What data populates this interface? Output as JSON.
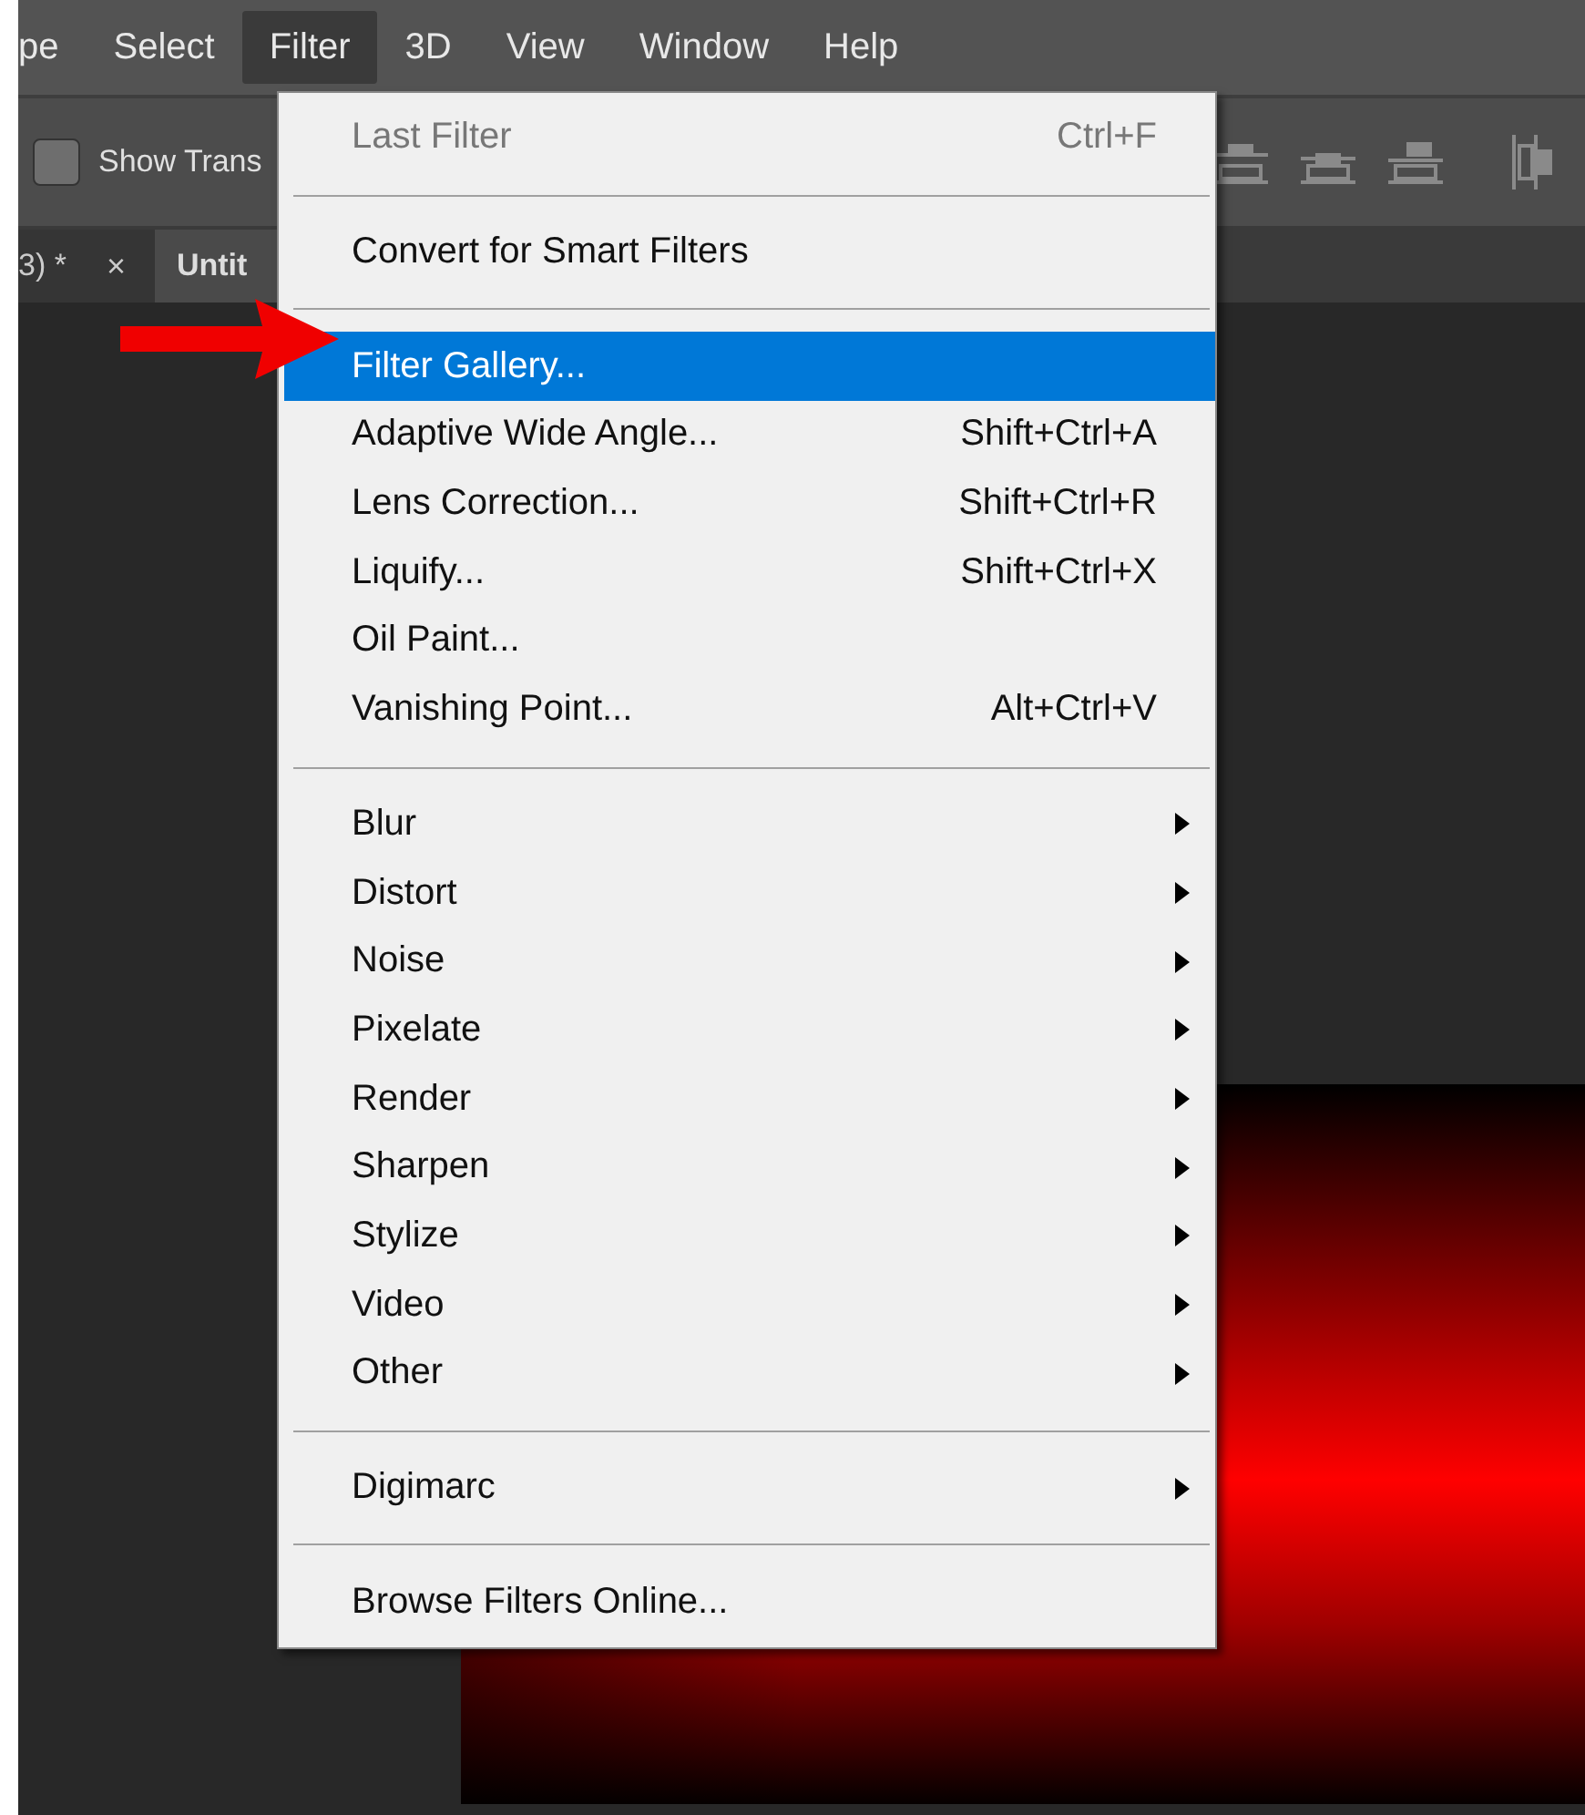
{
  "menubar": [
    {
      "label": "pe",
      "selected": false
    },
    {
      "label": "Select",
      "selected": false
    },
    {
      "label": "Filter",
      "selected": true
    },
    {
      "label": "3D",
      "selected": false
    },
    {
      "label": "View",
      "selected": false
    },
    {
      "label": "Window",
      "selected": false
    },
    {
      "label": "Help",
      "selected": false
    }
  ],
  "options_bar": {
    "checkbox": {
      "label": "Show Trans",
      "checked": false
    }
  },
  "document_tabs": [
    {
      "label": "3) *",
      "close": "×",
      "selected": false
    },
    {
      "label": "Untit",
      "selected": true
    }
  ],
  "filter_menu": [
    {
      "kind": "item",
      "label": "Last Filter",
      "shortcut": "Ctrl+F",
      "disabled": true,
      "selected": false,
      "submenu": false
    },
    {
      "kind": "separator"
    },
    {
      "kind": "item",
      "label": "Convert for Smart Filters",
      "disabled": false,
      "selected": false,
      "submenu": false
    },
    {
      "kind": "separator"
    },
    {
      "kind": "item",
      "label": "Filter Gallery...",
      "disabled": false,
      "selected": true,
      "submenu": false
    },
    {
      "kind": "item",
      "label": "Adaptive Wide Angle...",
      "shortcut": "Shift+Ctrl+A",
      "disabled": false,
      "selected": false,
      "submenu": false
    },
    {
      "kind": "item",
      "label": "Lens Correction...",
      "shortcut": "Shift+Ctrl+R",
      "disabled": false,
      "selected": false,
      "submenu": false
    },
    {
      "kind": "item",
      "label": "Liquify...",
      "shortcut": "Shift+Ctrl+X",
      "disabled": false,
      "selected": false,
      "submenu": false
    },
    {
      "kind": "item",
      "label": "Oil Paint...",
      "disabled": false,
      "selected": false,
      "submenu": false
    },
    {
      "kind": "item",
      "label": "Vanishing Point...",
      "shortcut": "Alt+Ctrl+V",
      "disabled": false,
      "selected": false,
      "submenu": false
    },
    {
      "kind": "separator"
    },
    {
      "kind": "item",
      "label": "Blur",
      "disabled": false,
      "selected": false,
      "submenu": true
    },
    {
      "kind": "item",
      "label": "Distort",
      "disabled": false,
      "selected": false,
      "submenu": true
    },
    {
      "kind": "item",
      "label": "Noise",
      "disabled": false,
      "selected": false,
      "submenu": true
    },
    {
      "kind": "item",
      "label": "Pixelate",
      "disabled": false,
      "selected": false,
      "submenu": true
    },
    {
      "kind": "item",
      "label": "Render",
      "disabled": false,
      "selected": false,
      "submenu": true
    },
    {
      "kind": "item",
      "label": "Sharpen",
      "disabled": false,
      "selected": false,
      "submenu": true
    },
    {
      "kind": "item",
      "label": "Stylize",
      "disabled": false,
      "selected": false,
      "submenu": true
    },
    {
      "kind": "item",
      "label": "Video",
      "disabled": false,
      "selected": false,
      "submenu": true
    },
    {
      "kind": "item",
      "label": "Other",
      "disabled": false,
      "selected": false,
      "submenu": true
    },
    {
      "kind": "separator"
    },
    {
      "kind": "item",
      "label": "Digimarc",
      "disabled": false,
      "selected": false,
      "submenu": true
    },
    {
      "kind": "separator"
    },
    {
      "kind": "item",
      "label": "Browse Filters Online...",
      "disabled": false,
      "selected": false,
      "submenu": false
    }
  ]
}
